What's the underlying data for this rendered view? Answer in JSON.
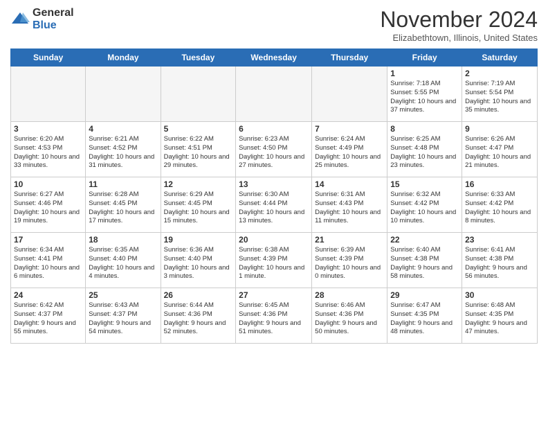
{
  "logo": {
    "general": "General",
    "blue": "Blue"
  },
  "header": {
    "title": "November 2024",
    "subtitle": "Elizabethtown, Illinois, United States"
  },
  "days_of_week": [
    "Sunday",
    "Monday",
    "Tuesday",
    "Wednesday",
    "Thursday",
    "Friday",
    "Saturday"
  ],
  "weeks": [
    [
      {
        "day": "",
        "info": ""
      },
      {
        "day": "",
        "info": ""
      },
      {
        "day": "",
        "info": ""
      },
      {
        "day": "",
        "info": ""
      },
      {
        "day": "",
        "info": ""
      },
      {
        "day": "1",
        "info": "Sunrise: 7:18 AM\nSunset: 5:55 PM\nDaylight: 10 hours and 37 minutes."
      },
      {
        "day": "2",
        "info": "Sunrise: 7:19 AM\nSunset: 5:54 PM\nDaylight: 10 hours and 35 minutes."
      }
    ],
    [
      {
        "day": "3",
        "info": "Sunrise: 6:20 AM\nSunset: 4:53 PM\nDaylight: 10 hours and 33 minutes."
      },
      {
        "day": "4",
        "info": "Sunrise: 6:21 AM\nSunset: 4:52 PM\nDaylight: 10 hours and 31 minutes."
      },
      {
        "day": "5",
        "info": "Sunrise: 6:22 AM\nSunset: 4:51 PM\nDaylight: 10 hours and 29 minutes."
      },
      {
        "day": "6",
        "info": "Sunrise: 6:23 AM\nSunset: 4:50 PM\nDaylight: 10 hours and 27 minutes."
      },
      {
        "day": "7",
        "info": "Sunrise: 6:24 AM\nSunset: 4:49 PM\nDaylight: 10 hours and 25 minutes."
      },
      {
        "day": "8",
        "info": "Sunrise: 6:25 AM\nSunset: 4:48 PM\nDaylight: 10 hours and 23 minutes."
      },
      {
        "day": "9",
        "info": "Sunrise: 6:26 AM\nSunset: 4:47 PM\nDaylight: 10 hours and 21 minutes."
      }
    ],
    [
      {
        "day": "10",
        "info": "Sunrise: 6:27 AM\nSunset: 4:46 PM\nDaylight: 10 hours and 19 minutes."
      },
      {
        "day": "11",
        "info": "Sunrise: 6:28 AM\nSunset: 4:45 PM\nDaylight: 10 hours and 17 minutes."
      },
      {
        "day": "12",
        "info": "Sunrise: 6:29 AM\nSunset: 4:45 PM\nDaylight: 10 hours and 15 minutes."
      },
      {
        "day": "13",
        "info": "Sunrise: 6:30 AM\nSunset: 4:44 PM\nDaylight: 10 hours and 13 minutes."
      },
      {
        "day": "14",
        "info": "Sunrise: 6:31 AM\nSunset: 4:43 PM\nDaylight: 10 hours and 11 minutes."
      },
      {
        "day": "15",
        "info": "Sunrise: 6:32 AM\nSunset: 4:42 PM\nDaylight: 10 hours and 10 minutes."
      },
      {
        "day": "16",
        "info": "Sunrise: 6:33 AM\nSunset: 4:42 PM\nDaylight: 10 hours and 8 minutes."
      }
    ],
    [
      {
        "day": "17",
        "info": "Sunrise: 6:34 AM\nSunset: 4:41 PM\nDaylight: 10 hours and 6 minutes."
      },
      {
        "day": "18",
        "info": "Sunrise: 6:35 AM\nSunset: 4:40 PM\nDaylight: 10 hours and 4 minutes."
      },
      {
        "day": "19",
        "info": "Sunrise: 6:36 AM\nSunset: 4:40 PM\nDaylight: 10 hours and 3 minutes."
      },
      {
        "day": "20",
        "info": "Sunrise: 6:38 AM\nSunset: 4:39 PM\nDaylight: 10 hours and 1 minute."
      },
      {
        "day": "21",
        "info": "Sunrise: 6:39 AM\nSunset: 4:39 PM\nDaylight: 10 hours and 0 minutes."
      },
      {
        "day": "22",
        "info": "Sunrise: 6:40 AM\nSunset: 4:38 PM\nDaylight: 9 hours and 58 minutes."
      },
      {
        "day": "23",
        "info": "Sunrise: 6:41 AM\nSunset: 4:38 PM\nDaylight: 9 hours and 56 minutes."
      }
    ],
    [
      {
        "day": "24",
        "info": "Sunrise: 6:42 AM\nSunset: 4:37 PM\nDaylight: 9 hours and 55 minutes."
      },
      {
        "day": "25",
        "info": "Sunrise: 6:43 AM\nSunset: 4:37 PM\nDaylight: 9 hours and 54 minutes."
      },
      {
        "day": "26",
        "info": "Sunrise: 6:44 AM\nSunset: 4:36 PM\nDaylight: 9 hours and 52 minutes."
      },
      {
        "day": "27",
        "info": "Sunrise: 6:45 AM\nSunset: 4:36 PM\nDaylight: 9 hours and 51 minutes."
      },
      {
        "day": "28",
        "info": "Sunrise: 6:46 AM\nSunset: 4:36 PM\nDaylight: 9 hours and 50 minutes."
      },
      {
        "day": "29",
        "info": "Sunrise: 6:47 AM\nSunset: 4:35 PM\nDaylight: 9 hours and 48 minutes."
      },
      {
        "day": "30",
        "info": "Sunrise: 6:48 AM\nSunset: 4:35 PM\nDaylight: 9 hours and 47 minutes."
      }
    ]
  ]
}
